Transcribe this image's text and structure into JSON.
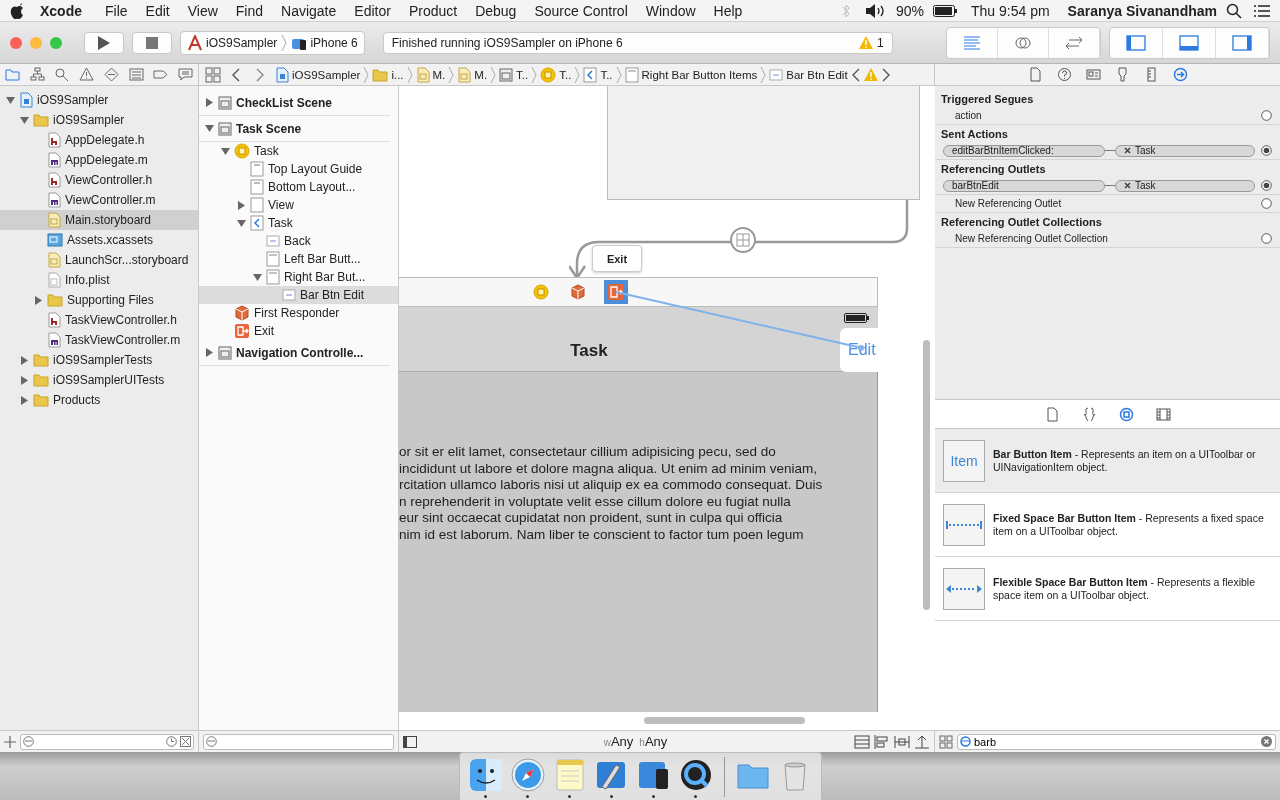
{
  "menubar": {
    "app": "Xcode",
    "items": [
      "File",
      "Edit",
      "View",
      "Find",
      "Navigate",
      "Editor",
      "Product",
      "Debug",
      "Source Control",
      "Window",
      "Help"
    ],
    "battery": "90%",
    "clock": "Thu 9:54 pm",
    "user": "Saranya Sivanandham"
  },
  "toolbar": {
    "scheme": "iOS9Sampler",
    "device": "iPhone 6",
    "status": "Finished running iOS9Sampler on iPhone 6",
    "warning_count": "1",
    "editor_modes": [
      {
        "selected": true
      },
      {
        "selected": false
      },
      {
        "selected": false
      }
    ],
    "panels": [
      {
        "selected": true
      },
      {
        "selected": true
      },
      {
        "selected": true
      }
    ]
  },
  "navigator_tabs": [
    {
      "selected": true
    },
    {
      "selected": false
    },
    {
      "selected": false
    },
    {
      "selected": false
    },
    {
      "selected": false
    },
    {
      "selected": false
    },
    {
      "selected": false
    },
    {
      "selected": false
    }
  ],
  "jump_bar": [
    {
      "text": "iOS9Sampler",
      "kind": "project"
    },
    {
      "text": "i...",
      "kind": "folder"
    },
    {
      "text": "M.",
      "kind": "storyboard"
    },
    {
      "text": "M.",
      "kind": "storyboard"
    },
    {
      "text": "T..",
      "kind": "scene"
    },
    {
      "text": "T..",
      "kind": "vc"
    },
    {
      "text": "T..",
      "kind": "navitem"
    },
    {
      "text": "Right Bar Button Items",
      "kind": "bararray"
    },
    {
      "text": "Bar Btn Edit",
      "kind": "baritem"
    }
  ],
  "inspector_tabs": [
    {
      "selected": false
    },
    {
      "selected": false
    },
    {
      "selected": false
    },
    {
      "selected": false
    },
    {
      "selected": false
    },
    {
      "selected": true
    }
  ],
  "file_tree": [
    {
      "name": "iOS9Sampler",
      "kind": "project",
      "selected": false,
      "expanded": true,
      "children": [
        {
          "name": "iOS9Sampler",
          "kind": "folder",
          "selected": false,
          "expanded": true,
          "children": [
            {
              "name": "AppDelegate.h",
              "kind": "h",
              "selected": false
            },
            {
              "name": "AppDelegate.m",
              "kind": "m",
              "selected": false
            },
            {
              "name": "ViewController.h",
              "kind": "h",
              "selected": false
            },
            {
              "name": "ViewController.m",
              "kind": "m",
              "selected": false
            },
            {
              "name": "Main.storyboard",
              "kind": "storyboard",
              "selected": true
            },
            {
              "name": "Assets.xcassets",
              "kind": "assets",
              "selected": false
            },
            {
              "name": "LaunchScr...storyboard",
              "kind": "storyboard",
              "selected": false
            },
            {
              "name": "Info.plist",
              "kind": "plist",
              "selected": false
            },
            {
              "name": "Supporting Files",
              "kind": "folder",
              "selected": false,
              "expanded": false
            },
            {
              "name": "TaskViewController.h",
              "kind": "h",
              "selected": false
            },
            {
              "name": "TaskViewController.m",
              "kind": "m",
              "selected": false
            }
          ]
        },
        {
          "name": "iOS9SamplerTests",
          "kind": "folder",
          "selected": false,
          "expanded": false
        },
        {
          "name": "iOS9SamplerUITests",
          "kind": "folder",
          "selected": false,
          "expanded": false
        },
        {
          "name": "Products",
          "kind": "folder",
          "selected": false,
          "expanded": false
        }
      ]
    }
  ],
  "outline": [
    {
      "name": "CheckList Scene",
      "kind": "scene",
      "selected": false,
      "expanded": false
    },
    {
      "name": "Task Scene",
      "kind": "scene",
      "selected": false,
      "expanded": true,
      "children": [
        {
          "name": "Task",
          "kind": "vc",
          "selected": false,
          "expanded": true,
          "children": [
            {
              "name": "Top Layout Guide",
              "kind": "guide",
              "selected": false
            },
            {
              "name": "Bottom Layout...",
              "kind": "guide",
              "selected": false
            },
            {
              "name": "View",
              "kind": "view",
              "selected": false,
              "expanded": false
            },
            {
              "name": "Task",
              "kind": "navitem",
              "selected": false,
              "expanded": true,
              "children": [
                {
                  "name": "Back",
                  "kind": "baritem",
                  "selected": false
                },
                {
                  "name": "Left Bar Butt...",
                  "kind": "bararray",
                  "selected": false
                },
                {
                  "name": "Right Bar But...",
                  "kind": "bararray",
                  "selected": false,
                  "expanded": true,
                  "children": [
                    {
                      "name": "Bar Btn Edit",
                      "kind": "baritem",
                      "selected": true
                    }
                  ]
                }
              ]
            }
          ]
        },
        {
          "name": "First Responder",
          "kind": "responder",
          "selected": false
        },
        {
          "name": "Exit",
          "kind": "exit",
          "selected": false
        }
      ]
    },
    {
      "name": "Navigation Controlle...",
      "kind": "scene",
      "selected": false,
      "expanded": false
    }
  ],
  "canvas": {
    "tooltip": "Exit",
    "nav_title": "Task",
    "edit_button": "Edit",
    "body_lines": [
      "or sit er elit lamet, consectetaur cillium adipisicing pecu, sed do",
      "incididunt ut labore et dolore magna aliqua. Ut enim ad minim veniam,",
      "rcitation ullamco laboris nisi ut aliquip ex ea commodo consequat. Duis",
      "n reprehenderit in voluptate velit esse cillum dolore eu fugiat nulla",
      "eur sint occaecat cupidatat non proident, sunt in culpa qui officia",
      "nim id est laborum. Nam liber te conscient to factor tum poen legum"
    ],
    "size_class": [
      {
        "prefix": "w",
        "value": "Any"
      },
      {
        "prefix": "h",
        "value": "Any"
      }
    ]
  },
  "connections": [
    {
      "title": "Triggered Segues",
      "rows": [
        {
          "kind": "empty",
          "label": "action",
          "connected": false
        }
      ]
    },
    {
      "title": "Sent Actions",
      "rows": [
        {
          "kind": "link",
          "source": "editBarBtnItemClicked:",
          "target": "Task",
          "connected": true
        }
      ]
    },
    {
      "title": "Referencing Outlets",
      "rows": [
        {
          "kind": "link",
          "source": "barBtnEdit",
          "target": "Task",
          "connected": true
        },
        {
          "kind": "empty",
          "label": "New Referencing Outlet",
          "connected": false
        }
      ]
    },
    {
      "title": "Referencing Outlet Collections",
      "rows": [
        {
          "kind": "empty",
          "label": "New Referencing Outlet Collection",
          "connected": false
        }
      ]
    }
  ],
  "library_tabs": [
    {
      "selected": false
    },
    {
      "selected": false
    },
    {
      "selected": true
    },
    {
      "selected": false
    }
  ],
  "library": [
    {
      "kind": "item",
      "thumb": "Item",
      "name": "Bar Button Item",
      "description": " - Represents an item on a UIToolbar or UINavigationItem object.",
      "selected": true
    },
    {
      "kind": "fixed",
      "name": "Fixed Space Bar Button Item",
      "description": " - Represents a fixed space item on a UIToolbar object.",
      "selected": false
    },
    {
      "kind": "flexible",
      "name": "Flexible Space Bar Button Item",
      "description": " - Represents a flexible space item on a UIToolbar object.",
      "selected": false
    }
  ],
  "library_search": "barb",
  "dock": [
    {
      "kind": "finder",
      "running": true
    },
    {
      "kind": "safari",
      "running": true
    },
    {
      "kind": "notes",
      "running": true
    },
    {
      "kind": "xcode",
      "running": true
    },
    {
      "kind": "simulator",
      "running": true
    },
    {
      "kind": "quicktime",
      "running": true
    },
    {
      "kind": "divider"
    },
    {
      "kind": "folder",
      "running": false
    },
    {
      "kind": "trash",
      "running": false
    }
  ]
}
